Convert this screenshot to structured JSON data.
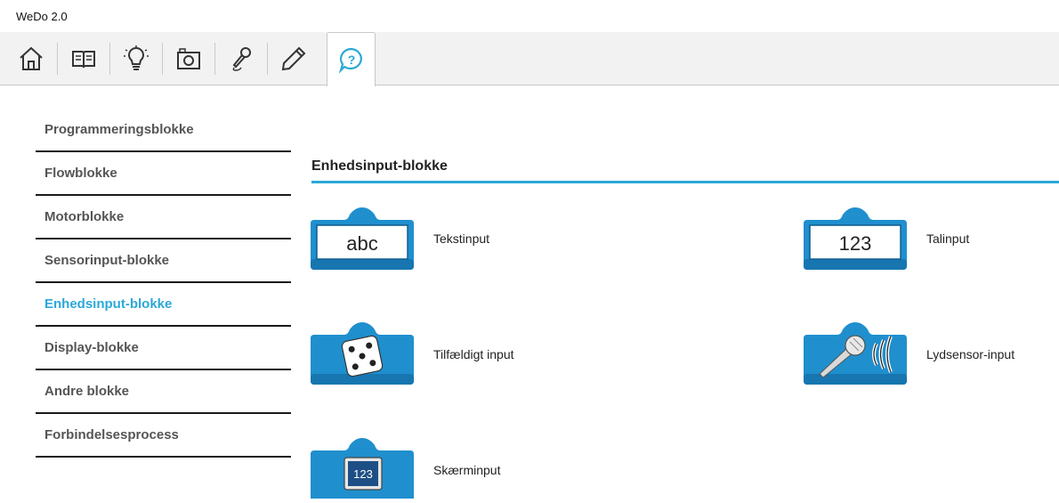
{
  "app": {
    "title": "WeDo 2.0"
  },
  "toolbar": {
    "tools": [
      {
        "name": "home",
        "icon": "home-icon"
      },
      {
        "name": "book",
        "icon": "book-icon"
      },
      {
        "name": "idea",
        "icon": "lightbulb-icon"
      },
      {
        "name": "camera",
        "icon": "camera-icon"
      },
      {
        "name": "record",
        "icon": "microphone-pen-icon"
      },
      {
        "name": "edit",
        "icon": "pencil-icon"
      },
      {
        "name": "help",
        "icon": "help-bubble-icon",
        "active": true
      }
    ],
    "accent": "#2aa8d8"
  },
  "nav": {
    "items": [
      {
        "label": "Programmeringsblokke",
        "level": "top"
      },
      {
        "label": "Flowblokke",
        "level": "sub"
      },
      {
        "label": "Motorblokke",
        "level": "sub"
      },
      {
        "label": "Sensorinput-blokke",
        "level": "sub"
      },
      {
        "label": "Enhedsinput-blokke",
        "level": "sub",
        "active": true
      },
      {
        "label": "Display-blokke",
        "level": "sub"
      },
      {
        "label": "Andre blokke",
        "level": "sub"
      },
      {
        "label": "Forbindelsesprocess",
        "level": "top"
      }
    ]
  },
  "main": {
    "section_title": "Enhedsinput-blokke",
    "blocks": [
      {
        "label": "Tekstinput",
        "glyph": "abc",
        "icon": "text-input-icon"
      },
      {
        "label": "Talinput",
        "glyph": "123",
        "icon": "number-input-icon"
      },
      {
        "label": "Tilfældigt input",
        "icon": "dice-icon"
      },
      {
        "label": "Lydsensor-input",
        "icon": "microphone-icon"
      },
      {
        "label": "Skærminput",
        "glyph": "123",
        "icon": "display-input-icon"
      }
    ]
  }
}
